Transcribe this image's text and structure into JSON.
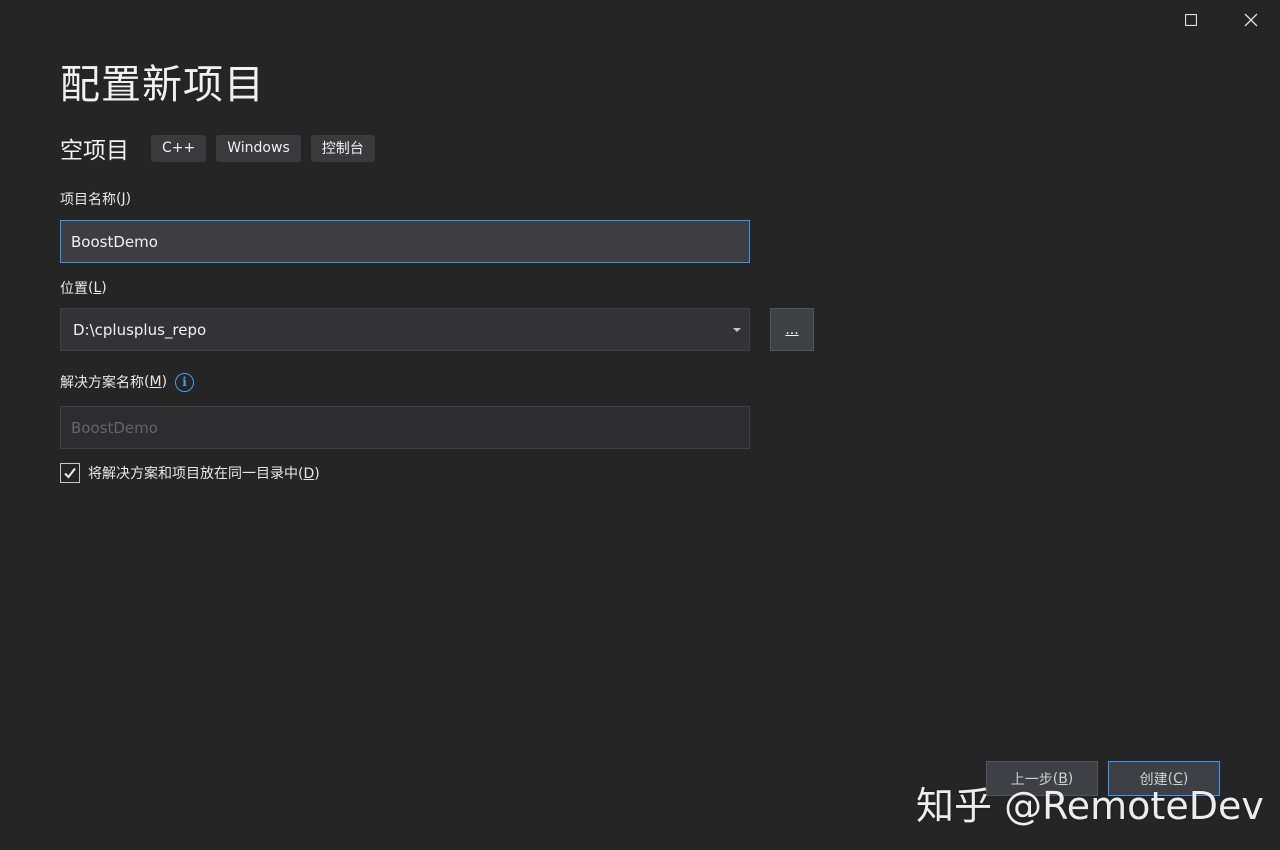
{
  "window_controls": {
    "maximize_icon": "maximize-icon",
    "close_icon": "close-icon"
  },
  "page_title": "配置新项目",
  "template": {
    "name": "空项目",
    "tags": [
      "C++",
      "Windows",
      "控制台"
    ]
  },
  "project_name": {
    "label": "项目名称",
    "accel": "J",
    "value": "BoostDemo"
  },
  "location": {
    "label": "位置",
    "accel": "L",
    "value": "D:\\cplusplus_repo",
    "browse_label": "..."
  },
  "solution_name": {
    "label": "解决方案名称",
    "accel": "M",
    "placeholder": "BoostDemo",
    "info_icon": "info-icon"
  },
  "same_dir": {
    "label": "将解决方案和项目放在同一目录中",
    "accel": "D",
    "checked": true
  },
  "footer": {
    "back_label": "上一步",
    "back_accel": "B",
    "create_label": "创建",
    "create_accel": "C"
  },
  "watermark": "知乎 @RemoteDev",
  "colors": {
    "background": "#252526",
    "accent": "#3399ff",
    "info": "#3ea3f5"
  }
}
